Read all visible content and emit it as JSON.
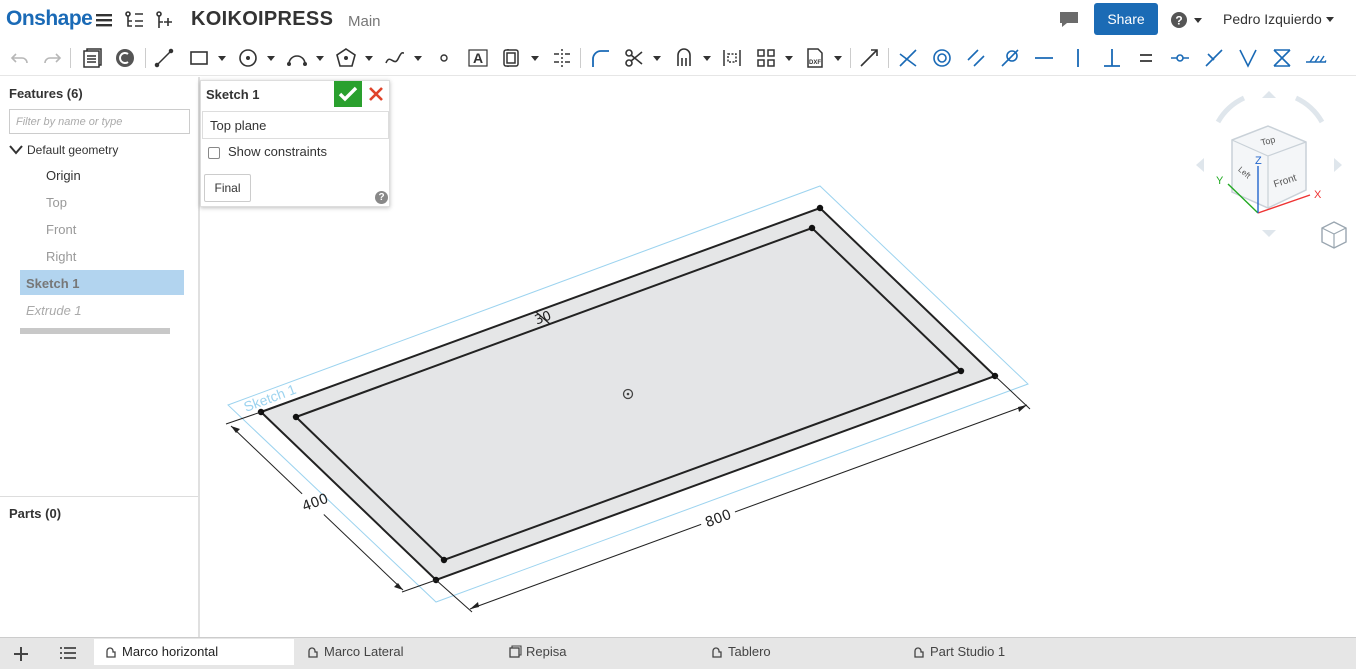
{
  "app": {
    "logo": "Onshape",
    "document_title": "KOIKOIPRESS",
    "branch": "Main",
    "share_label": "Share",
    "help_label": "?",
    "user_name": "Pedro Izquierdo",
    "accent_color": "#1b6bb5"
  },
  "feature_list": {
    "title": "Features (6)",
    "filter_placeholder": "Filter by name or type",
    "group_label": "Default geometry",
    "items": [
      {
        "label": "Origin",
        "state": "normal"
      },
      {
        "label": "Top",
        "state": "muted"
      },
      {
        "label": "Front",
        "state": "muted"
      },
      {
        "label": "Right",
        "state": "muted"
      },
      {
        "label": "Sketch 1",
        "state": "selected"
      },
      {
        "label": "Extrude 1",
        "state": "rolled-back"
      }
    ],
    "parts_title": "Parts (0)"
  },
  "sketch_dialog": {
    "title": "Sketch 1",
    "plane_value": "Top plane",
    "show_constraints_label": "Show constraints",
    "show_constraints_checked": false,
    "final_label": "Final"
  },
  "viewport": {
    "sketch_label": "Sketch 1",
    "dim_width": "400",
    "dim_length": "800",
    "dim_offset": "30",
    "view_cube": {
      "top": "Top",
      "front": "Front",
      "left": "Left",
      "axis_x": "X",
      "axis_y": "Y",
      "axis_z": "Z"
    }
  },
  "tabs": [
    {
      "label": "Marco horizontal",
      "active": true
    },
    {
      "label": "Marco Lateral",
      "active": false
    },
    {
      "label": "Repisa",
      "active": false
    },
    {
      "label": "Tablero",
      "active": false
    },
    {
      "label": "Part Studio 1",
      "active": false
    }
  ]
}
